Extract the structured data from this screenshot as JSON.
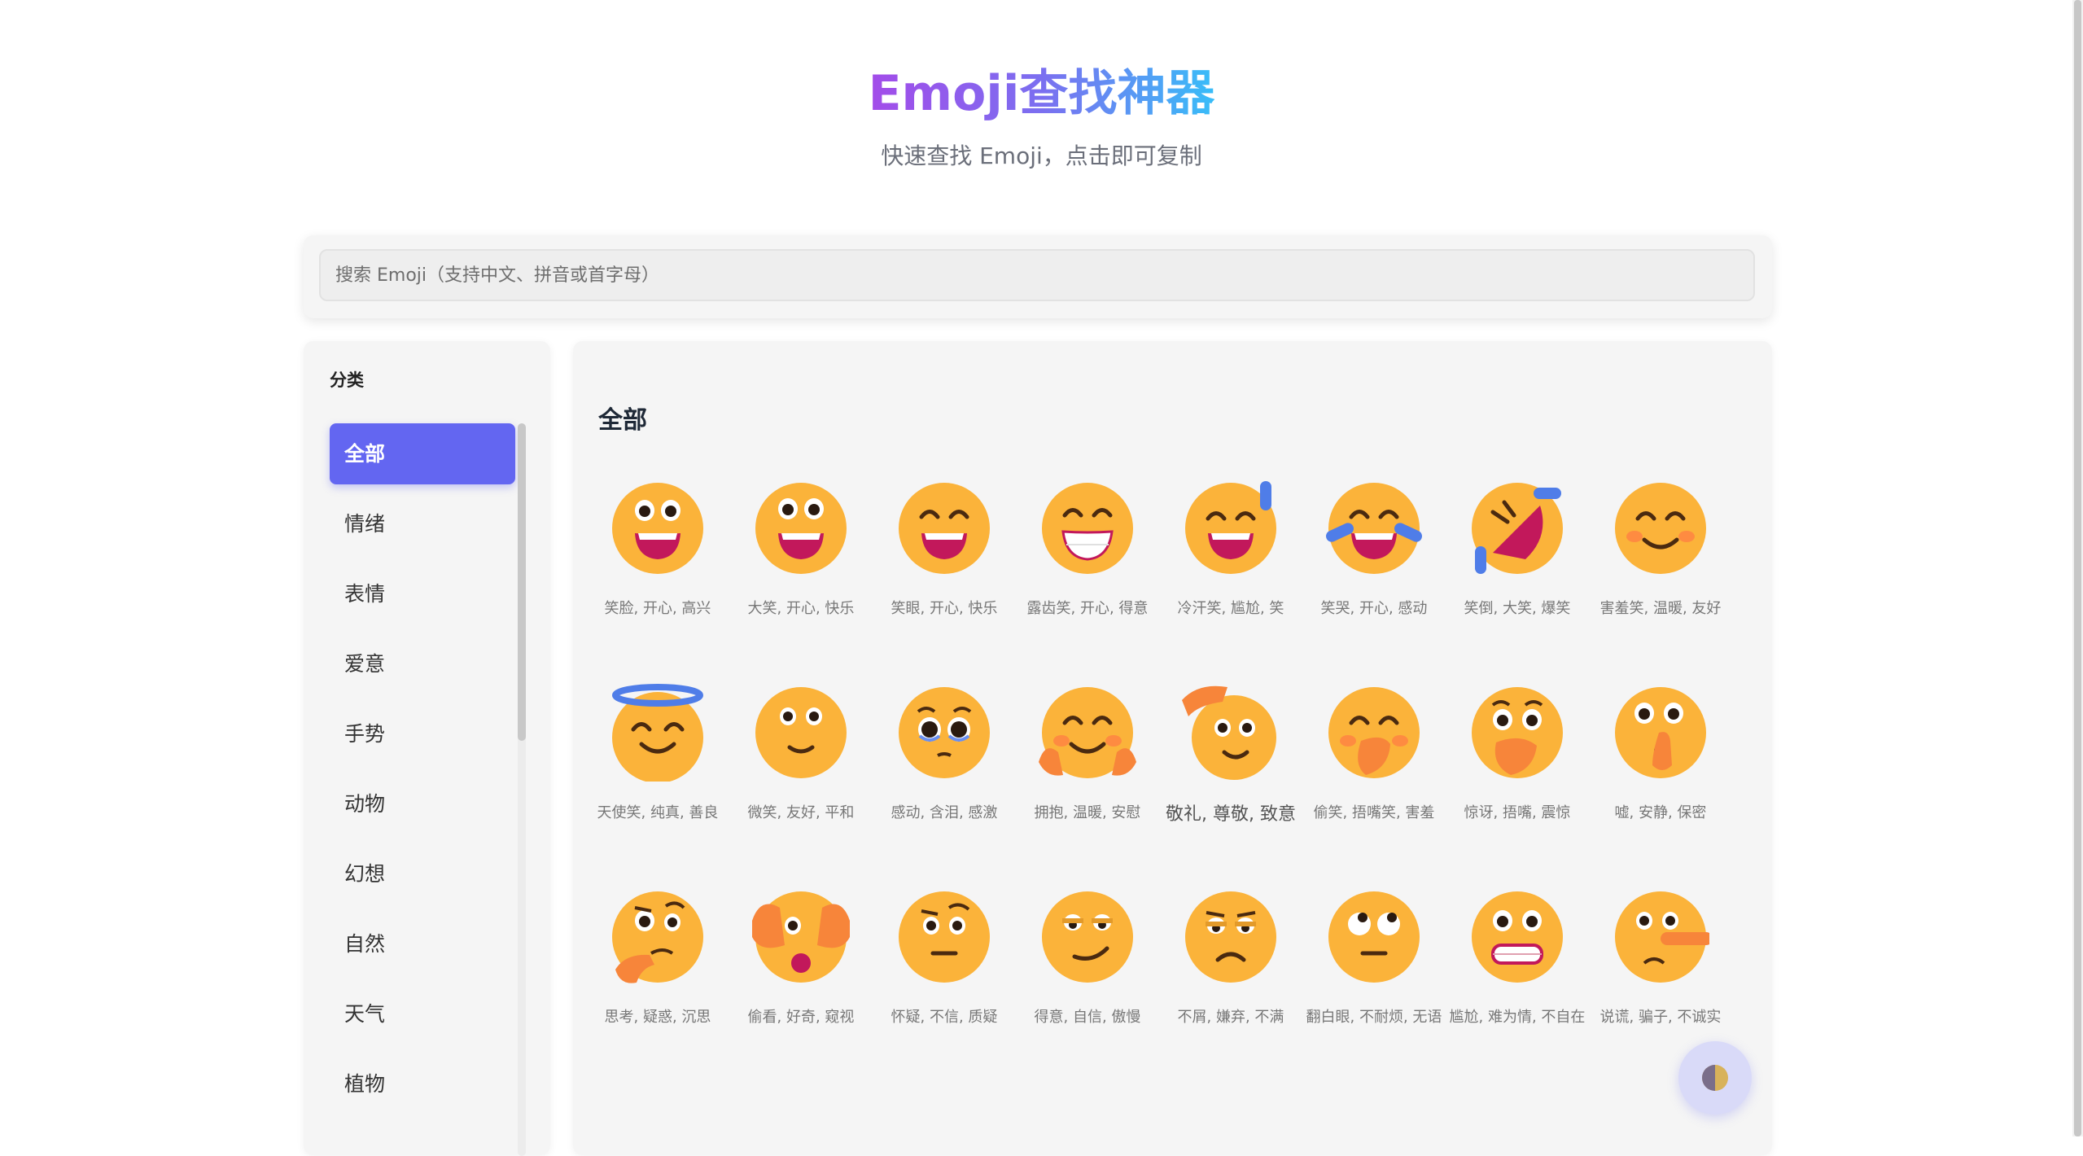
{
  "header": {
    "title": "Emoji查找神器",
    "subtitle": "快速查找 Emoji，点击即可复制"
  },
  "search": {
    "placeholder": "搜索 Emoji（支持中文、拼音或首字母）",
    "value": ""
  },
  "sidebar": {
    "title": "分类",
    "categories": [
      {
        "label": "全部",
        "active": true
      },
      {
        "label": "情绪"
      },
      {
        "label": "表情"
      },
      {
        "label": "爱意"
      },
      {
        "label": "手势"
      },
      {
        "label": "动物"
      },
      {
        "label": "幻想"
      },
      {
        "label": "自然"
      },
      {
        "label": "天气"
      },
      {
        "label": "植物"
      }
    ]
  },
  "main": {
    "section_title": "全部",
    "emojis": [
      {
        "icon": "grinning-face-icon",
        "label": "笑脸, 开心, 高兴"
      },
      {
        "icon": "grinning-big-eyes-icon",
        "label": "大笑, 开心, 快乐"
      },
      {
        "icon": "grinning-smiling-eyes-icon",
        "label": "笑眼, 开心, 快乐"
      },
      {
        "icon": "beaming-face-icon",
        "label": "露齿笑, 开心, 得意"
      },
      {
        "icon": "grinning-sweat-icon",
        "label": "冷汗笑, 尴尬, 笑"
      },
      {
        "icon": "tears-of-joy-icon",
        "label": "笑哭, 开心, 感动"
      },
      {
        "icon": "rolling-on-floor-laughing-icon",
        "label": "笑倒, 大笑, 爆笑"
      },
      {
        "icon": "smiling-blush-icon",
        "label": "害羞笑, 温暖, 友好"
      },
      {
        "icon": "halo-face-icon",
        "label": "天使笑, 纯真, 善良"
      },
      {
        "icon": "slight-smile-icon",
        "label": "微笑, 友好, 平和"
      },
      {
        "icon": "holding-back-tears-icon",
        "label": "感动, 含泪, 感激"
      },
      {
        "icon": "hugging-face-icon",
        "label": "拥抱, 温暖, 安慰"
      },
      {
        "icon": "saluting-face-icon",
        "label": "敬礼, 尊敬, 致意"
      },
      {
        "icon": "hand-over-mouth-icon",
        "label": "偷笑, 捂嘴笑, 害羞"
      },
      {
        "icon": "open-eyes-hand-over-mouth-icon",
        "label": "惊讶, 捂嘴, 震惊"
      },
      {
        "icon": "shushing-face-icon",
        "label": "嘘, 安静, 保密"
      },
      {
        "icon": "thinking-face-icon",
        "label": "思考, 疑惑, 沉思"
      },
      {
        "icon": "peeking-eye-icon",
        "label": "偷看, 好奇, 窥视"
      },
      {
        "icon": "raised-eyebrow-icon",
        "label": "怀疑, 不信, 质疑"
      },
      {
        "icon": "smirking-face-icon",
        "label": "得意, 自信, 傲慢"
      },
      {
        "icon": "unamused-face-icon",
        "label": "不屑, 嫌弃, 不满"
      },
      {
        "icon": "rolling-eyes-icon",
        "label": "翻白眼, 不耐烦, 无语"
      },
      {
        "icon": "grimacing-face-icon",
        "label": "尴尬, 难为情, 不自在"
      },
      {
        "icon": "lying-face-icon",
        "label": "说谎, 骗子, 不诚实"
      }
    ]
  },
  "theme_toggle": {
    "icon": "half-moon-theme-icon"
  },
  "colors": {
    "accent": "#6366f1",
    "face": "#fbb33a",
    "mouth": "#c2185b",
    "blush": "#ff7a45",
    "hand": "#f7853a",
    "halo": "#4f7de8"
  }
}
